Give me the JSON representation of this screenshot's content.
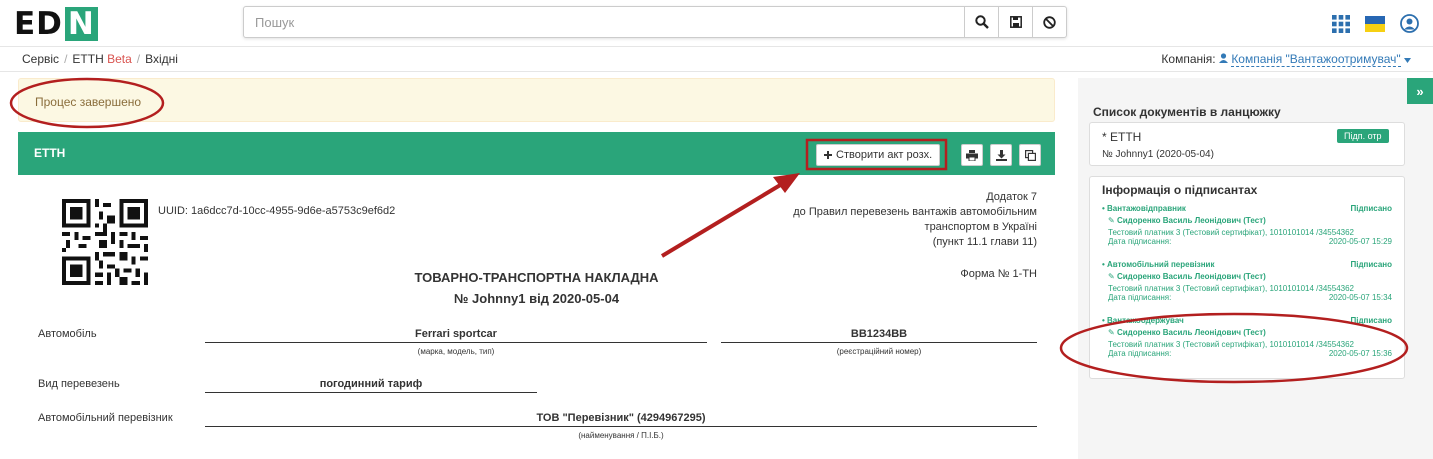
{
  "header": {
    "logo": {
      "prefix": "ED",
      "suffix": "N"
    },
    "search": {
      "placeholder": "Пошук"
    },
    "colors": {
      "accent": "#2aa57a",
      "alert_bg": "#fcf8e3",
      "annotation": "#b31f1f"
    }
  },
  "breadcrumb": {
    "service": "Сервіс",
    "etth": "ЕТТН",
    "beta": "Beta",
    "inbox": "Вхідні"
  },
  "company": {
    "label": "Компанія:",
    "name": "Компанія \"Вантажоотримувач\""
  },
  "alert": {
    "text": "Процес завершено"
  },
  "panel": {
    "title": "ЕТТН",
    "create_button": "Створити акт розх."
  },
  "document": {
    "uuid": "UUID: 1a6dcc7d-10cc-4955-9d6e-a5753c9ef6d2",
    "appendix": [
      "Додаток 7",
      "до Правил перевезень вантажів автомобільним",
      "транспортом в Україні",
      "(пункт 11.1 глави 11)"
    ],
    "title": "ТОВАРНО-ТРАНСПОРТНА НАКЛАДНА",
    "number": "№ Johnny1 від 2020-05-04",
    "form": "Форма № 1-ТН",
    "car_label": "Автомобіль",
    "car_value": "Ferrari sportcar",
    "car_hint": "(марка, модель, тип)",
    "plate_value": "BB1234BB",
    "plate_hint": "(реєстраційний номер)",
    "transport_type_label": "Вид перевезень",
    "transport_type_value": "погодинний тариф",
    "carrier_label": "Автомобільний перевізник",
    "carrier_value": "ТОВ \"Перевізник\" (4294967295)",
    "carrier_hint": "(найменування / П.І.Б.)"
  },
  "sidebar": {
    "chain_title": "Список документів в ланцюжку",
    "chain_doc": {
      "name": "* ЕТТН",
      "number": "№ Johnny1 (2020-05-04)",
      "badge": "Підп. отр"
    },
    "signers_title": "Інформація о підписантах",
    "signers": [
      {
        "role": "Вантажовідправник",
        "status": "Підписано",
        "person": "Сидоренко Василь Леонідович (Тест)",
        "cert": "Тестовий платник 3 (Тестовий сертифікат), 1010101014 /34554362",
        "date_label": "Дата підписання:",
        "date": "2020-05-07 15:29"
      },
      {
        "role": "Автомобільний перевізник",
        "status": "Підписано",
        "person": "Сидоренко Василь Леонідович (Тест)",
        "cert": "Тестовий платник 3 (Тестовий сертифікат), 1010101014 /34554362",
        "date_label": "Дата підписання:",
        "date": "2020-05-07 15:34"
      },
      {
        "role": "Вантажоодержувач",
        "status": "Підписано",
        "person": "Сидоренко Василь Леонідович (Тест)",
        "cert": "Тестовий платник 3 (Тестовий сертифікат), 1010101014 /34554362",
        "date_label": "Дата підписання:",
        "date": "2020-05-07 15:36"
      }
    ]
  }
}
